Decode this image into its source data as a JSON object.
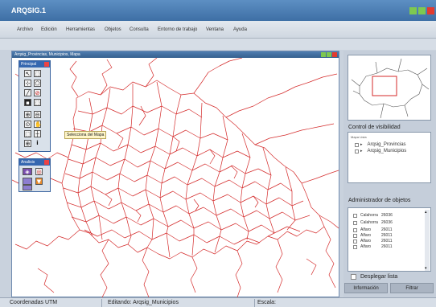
{
  "app": {
    "title": "ARQSIG.1"
  },
  "menu": [
    "Archivo",
    "Edición",
    "Herramientas",
    "Objetos",
    "Consulta",
    "Entorno de trabajo",
    "Ventana",
    "Ayuda"
  ],
  "map_window": {
    "title": "Arqsig_Provincias, Municipios, Mapa"
  },
  "palette_principal": {
    "title": "Principal"
  },
  "palette_analisis": {
    "title": "Analisis"
  },
  "tooltip": "Selecciona del Mapa",
  "visibility": {
    "title": "Control de visibilidad",
    "caption": "Mapa Lista",
    "layers": [
      "Arqsig_Provincias",
      "Arqsig_Municipios"
    ]
  },
  "objects": {
    "title": "Administrador de objetos",
    "rows": [
      {
        "name": "Calahorra",
        "code": "26036"
      },
      {
        "name": "Calahorra",
        "code": "26036"
      },
      {
        "name": "Alfaro",
        "code": "26011"
      },
      {
        "name": "Alfaro",
        "code": "26011"
      },
      {
        "name": "Alfaro",
        "code": "26011"
      },
      {
        "name": "Alfaro",
        "code": "26011"
      }
    ]
  },
  "desplegar_label": "Desplegar lista",
  "buttons": {
    "info": "Información",
    "filter": "Filtrar"
  },
  "status": {
    "coords": "Coordenadas UTM",
    "editing": "Editando: Arqsig_Municipios",
    "scale": "Escala:"
  },
  "colors": {
    "titlebar": "#3e6fa5",
    "map_lines": "#d42a2a",
    "palette_header": "#3567b0"
  }
}
